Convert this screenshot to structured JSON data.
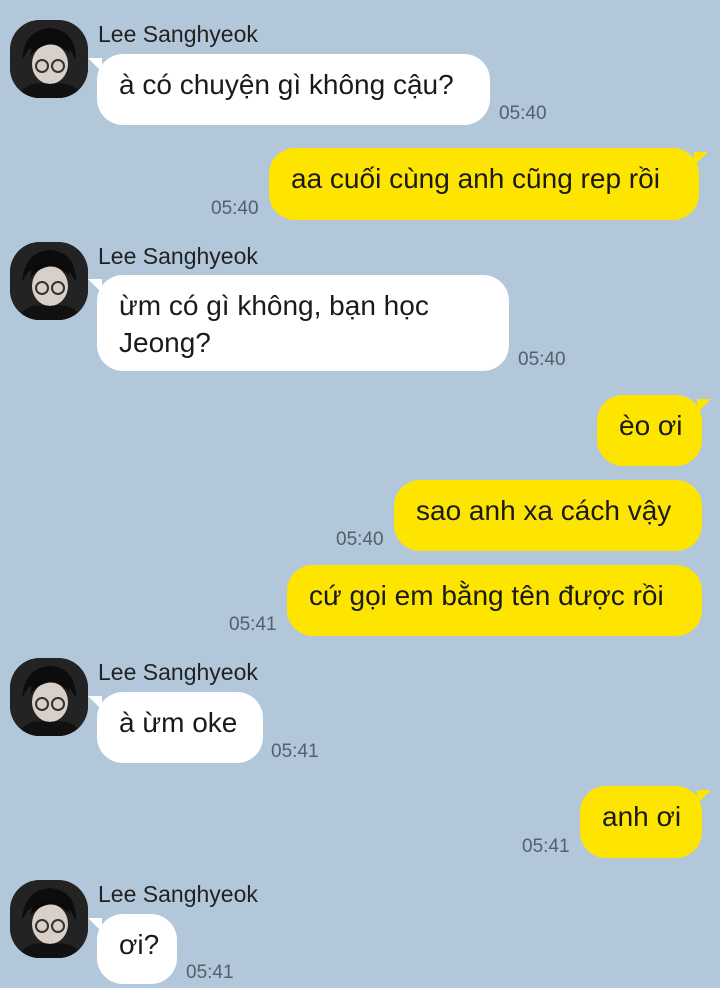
{
  "contact": {
    "name": "Lee Sanghyeok"
  },
  "messages": [
    {
      "text": "à có chuyện gì không cậu?",
      "time": "05:40"
    },
    {
      "text": "aa cuối cùng anh cũng rep rồi",
      "time": "05:40"
    },
    {
      "text_line1": "ừm có gì không, bạn học",
      "text_line2": "Jeong?",
      "time": "05:40"
    },
    {
      "text": "èo ơi"
    },
    {
      "text": "sao anh xa cách vậy",
      "time": "05:40"
    },
    {
      "text": "cứ gọi em bằng tên được rồi",
      "time": "05:41"
    },
    {
      "text": "à ừm oke",
      "time": "05:41"
    },
    {
      "text": "anh ơi",
      "time": "05:41"
    },
    {
      "text": "ơi?",
      "time": "05:41"
    }
  ],
  "colors": {
    "background": "#b2c7d9",
    "incoming": "#ffffff",
    "outgoing": "#fee500"
  }
}
